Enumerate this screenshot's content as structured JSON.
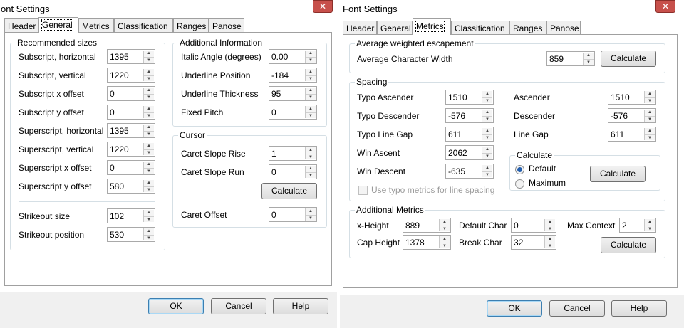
{
  "left": {
    "title": "ont Settings",
    "close": "✕",
    "tabs": [
      "Header",
      "General",
      "Metrics",
      "Classification",
      "Ranges",
      "Panose"
    ],
    "recommended": {
      "label": "Recommended sizes",
      "rows": [
        {
          "label": "Subscript, horizontal",
          "value": "1395"
        },
        {
          "label": "Subscript, vertical",
          "value": "1220"
        },
        {
          "label": "Subscript x offset",
          "value": "0"
        },
        {
          "label": "Subscript y offset",
          "value": "0"
        },
        {
          "label": "Superscript, horizontal",
          "value": "1395"
        },
        {
          "label": "Superscript, vertical",
          "value": "1220"
        },
        {
          "label": "Superscript x offset",
          "value": "0"
        },
        {
          "label": "Superscript y offset",
          "value": "580"
        },
        {
          "label": "Strikeout size",
          "value": "102"
        },
        {
          "label": "Strikeout position",
          "value": "530"
        }
      ]
    },
    "additional": {
      "label": "Additional Information",
      "rows": [
        {
          "label": "Italic Angle (degrees)",
          "value": "0.00"
        },
        {
          "label": "Underline Position",
          "value": "-184"
        },
        {
          "label": "Underline Thickness",
          "value": "95"
        },
        {
          "label": "Fixed Pitch",
          "value": "0"
        }
      ]
    },
    "cursor": {
      "label": "Cursor",
      "rows": [
        {
          "label": "Caret Slope Rise",
          "value": "1"
        },
        {
          "label": "Caret Slope Run",
          "value": "0"
        },
        {
          "label": "Caret Offset",
          "value": "0"
        }
      ],
      "calculate": "Calculate"
    },
    "ok": "OK",
    "cancel": "Cancel",
    "help": "Help"
  },
  "right": {
    "title": "Font Settings",
    "close": "✕",
    "tabs": [
      "Header",
      "General",
      "Metrics",
      "Classification",
      "Ranges",
      "Panose"
    ],
    "escapement": {
      "label": "Average weighted escapement",
      "row_label": "Average Character Width",
      "value": "859",
      "calculate": "Calculate"
    },
    "spacing": {
      "label": "Spacing",
      "left_rows": [
        {
          "label": "Typo Ascender",
          "value": "1510"
        },
        {
          "label": "Typo Descender",
          "value": "-576"
        },
        {
          "label": "Typo Line Gap",
          "value": "611"
        },
        {
          "label": "Win Ascent",
          "value": "2062"
        },
        {
          "label": "Win Descent",
          "value": "-635"
        }
      ],
      "right_rows": [
        {
          "label": "Ascender",
          "value": "1510"
        },
        {
          "label": "Descender",
          "value": "-576"
        },
        {
          "label": "Line Gap",
          "value": "611"
        }
      ],
      "calc_group": {
        "label": "Calculate",
        "opt_default": "Default",
        "opt_maximum": "Maximum",
        "button": "Calculate"
      },
      "use_typo": "Use typo metrics for line spacing"
    },
    "metrics": {
      "label": "Additional Metrics",
      "x_height_label": "x-Height",
      "x_height": "889",
      "cap_height_label": "Cap Height",
      "cap_height": "1378",
      "default_char_label": "Default Char",
      "default_char": "0",
      "break_char_label": "Break Char",
      "break_char": "32",
      "max_context_label": "Max Context",
      "max_context": "2",
      "calculate": "Calculate"
    },
    "ok": "OK",
    "cancel": "Cancel",
    "help": "Help"
  }
}
